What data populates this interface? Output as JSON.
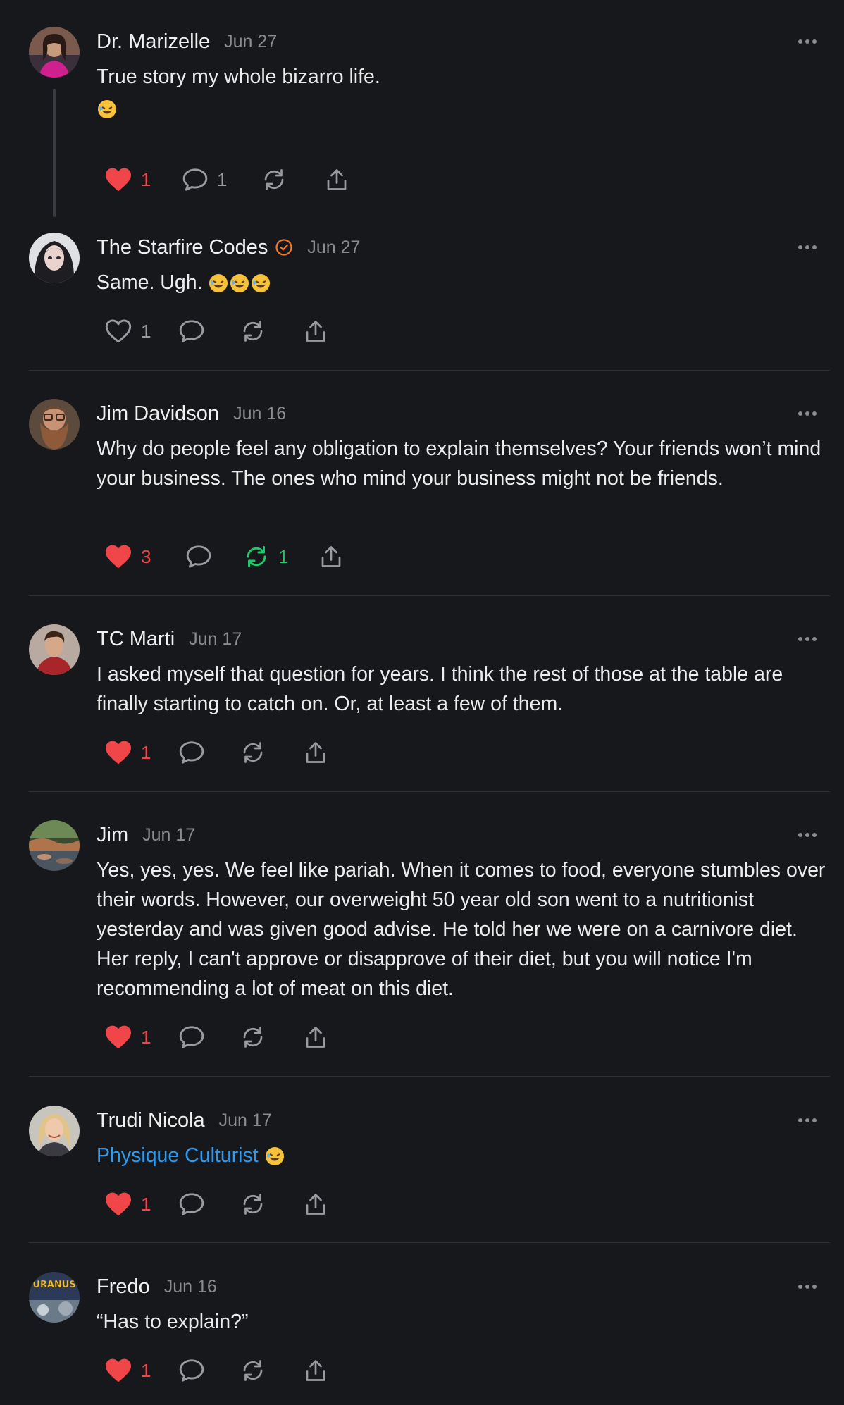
{
  "colors": {
    "background": "#17181b",
    "like_active": "#f0464a",
    "repost_active": "#1fc96b",
    "link": "#2f9bf0",
    "verified": "#f07a2a",
    "muted": "#8b8b90"
  },
  "posts": [
    {
      "author": "Dr. Marizelle",
      "date": "Jun 27",
      "text": "True story my whole bizarro life.",
      "emoji": "rolling-on-floor-laughing",
      "likes": "1",
      "liked": true,
      "replies": "1",
      "reposts": ""
    },
    {
      "author": "The Starfire Codes",
      "verified": true,
      "date": "Jun 27",
      "text": "Same. Ugh.",
      "likes": "1",
      "liked": false,
      "replies": "",
      "reposts": ""
    },
    {
      "author": "Jim Davidson",
      "date": "Jun 16",
      "text": "Why do people feel any obligation to explain themselves? Your friends won’t mind your business. The ones who mind your business might not be friends.",
      "likes": "3",
      "liked": true,
      "replies": "",
      "reposts": "1",
      "reposted": true
    },
    {
      "author": "TC Marti",
      "date": "Jun 17",
      "text": "I asked myself that question for years. I think the rest of those at the table are finally starting to catch on. Or, at least a few of them.",
      "likes": "1",
      "liked": true
    },
    {
      "author": "Jim",
      "date": "Jun 17",
      "text": "Yes, yes, yes. We feel like pariah. When it comes to food, everyone stumbles over their words. However, our overweight 50 year old son went to a nutritionist yesterday and was given good advise. He told her we were on a carnivore diet. Her reply, I can't approve or disapprove of their diet, but you will notice I'm recommending a lot of meat on this diet.",
      "likes": "1",
      "liked": true
    },
    {
      "author": "Trudi Nicola",
      "date": "Jun 17",
      "link_text": "Physique Culturist",
      "likes": "1",
      "liked": true
    },
    {
      "author": "Fredo",
      "date": "Jun 16",
      "text": "“Has to explain?”",
      "avatar_text": "URANUS",
      "likes": "1",
      "liked": true
    }
  ]
}
